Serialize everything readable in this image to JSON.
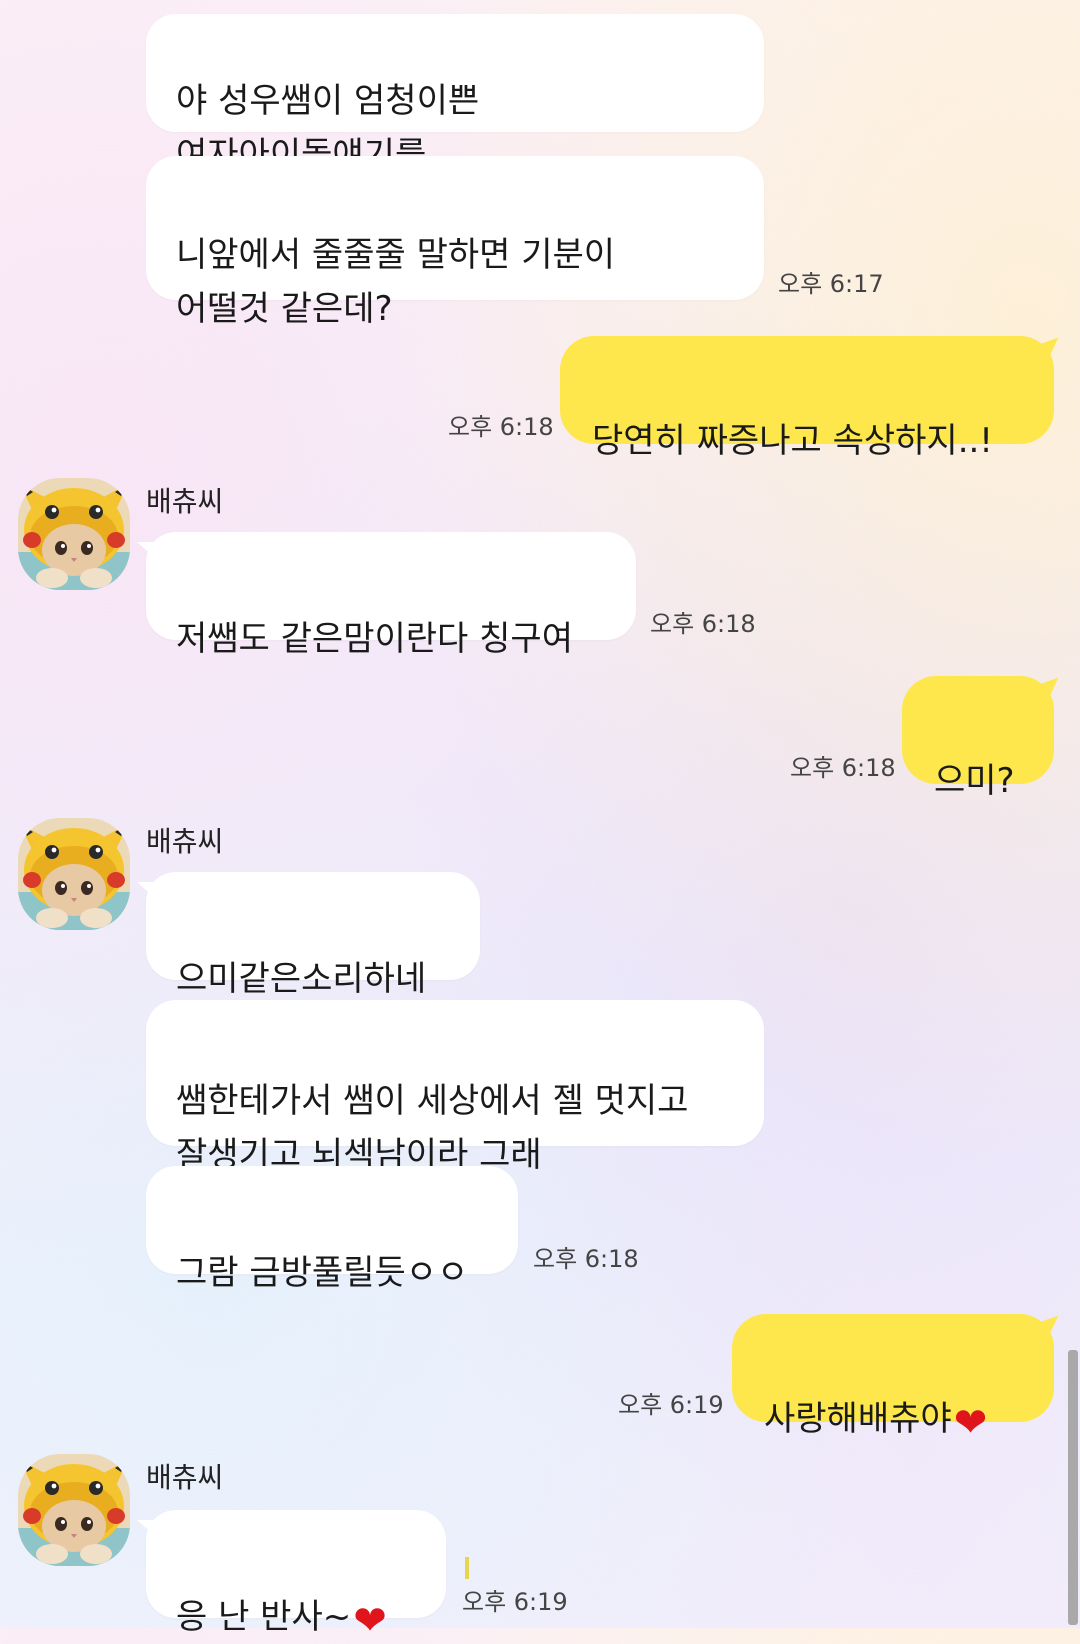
{
  "messages": [
    {
      "text": "야 성우쌤이 엄청이쁜\n여자아이돌얘기를"
    },
    {
      "text": "니앞에서 줄줄줄 말하면 기분이\n어떨것 같은데?",
      "time": "오후 6:17"
    },
    {
      "text": "당연히 짜증나고 속상하지..!",
      "time": "오후 6:18"
    },
    {
      "sender": "배츄씨",
      "text": "저쌤도 같은맘이란다 칭구여",
      "time": "오후 6:18"
    },
    {
      "text": "으미?",
      "time": "오후 6:18"
    },
    {
      "sender": "배츄씨",
      "text": "으미같은소리하네"
    },
    {
      "text": "쌤한테가서 쌤이 세상에서 젤 멋지고\n잘생기고 뇌섹남이라 그래"
    },
    {
      "text": "그람 금방풀릴듯ㅇㅇ",
      "time": "오후 6:18"
    },
    {
      "text": "사랑해배츄야",
      "emoji": "❤",
      "time": "오후 6:19"
    },
    {
      "sender": "배츄씨",
      "text": "응 난 반사~",
      "emoji": "❤",
      "time": "오후 6:19"
    }
  ],
  "avatar_icon": "cat-in-pikachu-hat",
  "colors": {
    "outgoing_bubble": "#fde74c",
    "incoming_bubble": "#ffffff",
    "heart": "#e0151b"
  }
}
